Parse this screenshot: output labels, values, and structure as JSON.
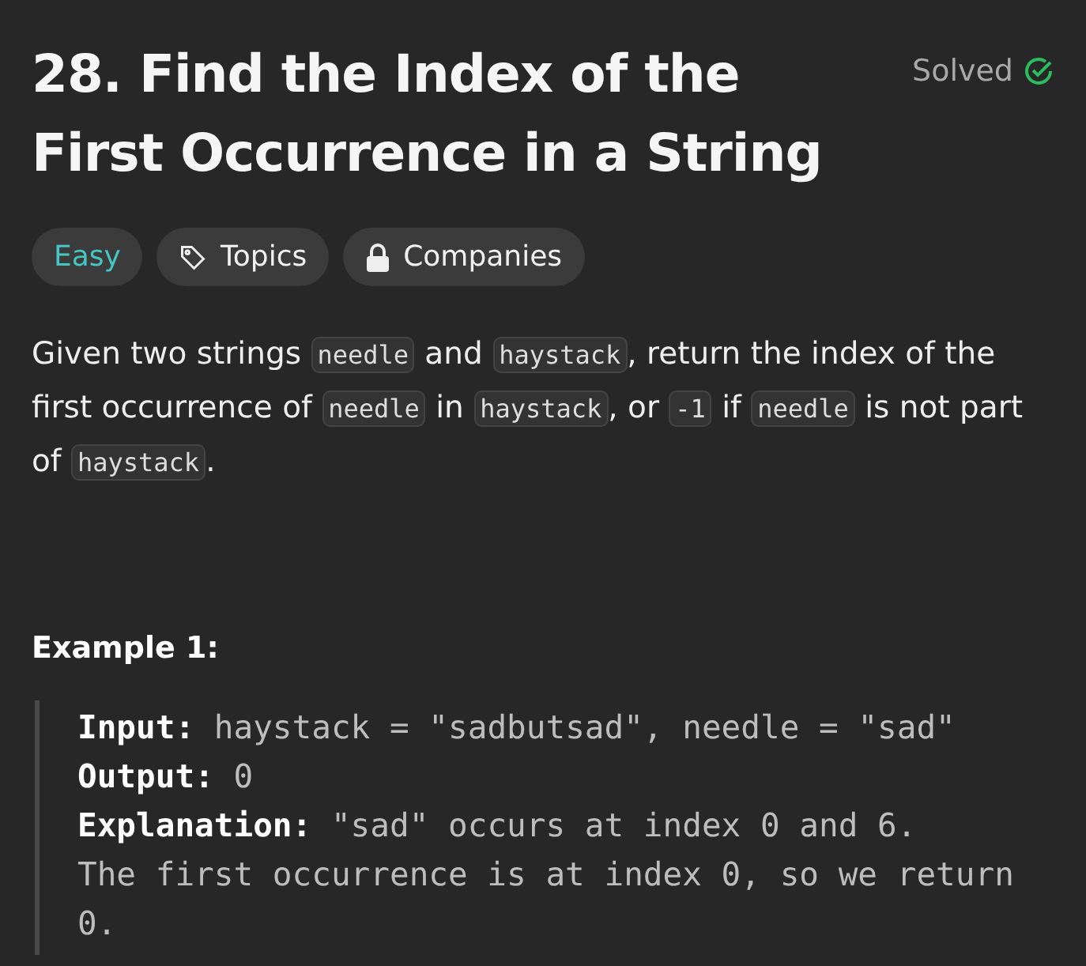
{
  "title": "28. Find the Index of the First Occurrence in a String",
  "status": {
    "label": "Solved",
    "solved": true
  },
  "tags": [
    {
      "kind": "difficulty",
      "label": "Easy"
    },
    {
      "kind": "topics",
      "label": "Topics"
    },
    {
      "kind": "companies",
      "label": "Companies"
    }
  ],
  "description": [
    {
      "kind": "text",
      "text": "Given two strings "
    },
    {
      "kind": "code",
      "text": "needle"
    },
    {
      "kind": "text",
      "text": " and "
    },
    {
      "kind": "code",
      "text": "haystack"
    },
    {
      "kind": "text",
      "text": ", return the index of the first occurrence of "
    },
    {
      "kind": "code",
      "text": "needle"
    },
    {
      "kind": "text",
      "text": " in "
    },
    {
      "kind": "code",
      "text": "haystack"
    },
    {
      "kind": "text",
      "text": ", or "
    },
    {
      "kind": "code",
      "text": "-1"
    },
    {
      "kind": "text",
      "text": " if "
    },
    {
      "kind": "code",
      "text": "needle"
    },
    {
      "kind": "text",
      "text": " is not part of "
    },
    {
      "kind": "code",
      "text": "haystack"
    },
    {
      "kind": "text",
      "text": "."
    }
  ],
  "example": {
    "heading": "Example 1:",
    "lines": [
      {
        "label": "Input:",
        "value": "haystack = \"sadbutsad\", needle = \"sad\""
      },
      {
        "label": "Output:",
        "value": "0"
      },
      {
        "label": "Explanation:",
        "value": "\"sad\" occurs at index 0 and 6.\nThe first occurrence is at index 0, so we return 0."
      }
    ]
  }
}
